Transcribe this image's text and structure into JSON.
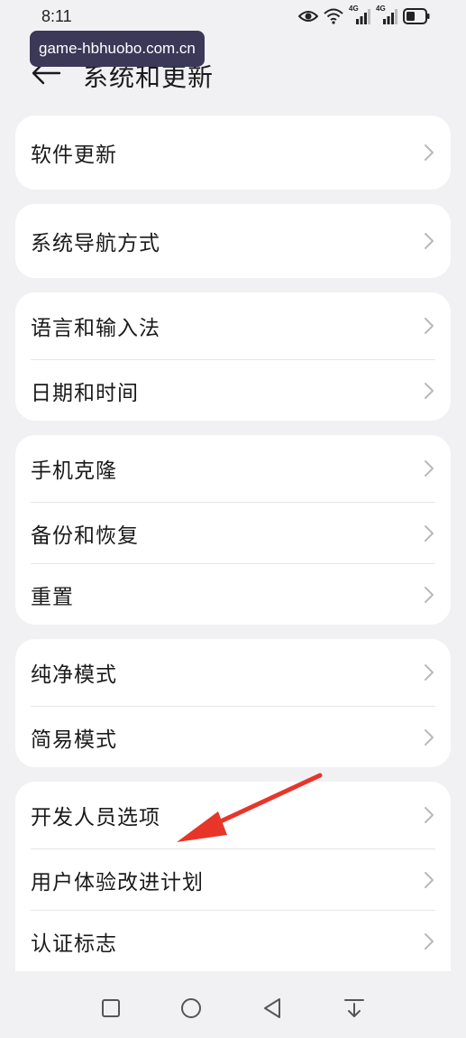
{
  "status_bar": {
    "time": "8:11",
    "network_label_1": "4G",
    "network_label_2": "4G",
    "icons": [
      "eye-icon",
      "wifi-icon",
      "signal-icon",
      "signal-icon",
      "battery-icon"
    ]
  },
  "watermark": {
    "text": "game-hbhuobo.com.cn"
  },
  "header": {
    "title": "系统和更新",
    "back_icon": "back-arrow-icon"
  },
  "groups": [
    {
      "items": [
        {
          "label": "软件更新"
        }
      ]
    },
    {
      "items": [
        {
          "label": "系统导航方式"
        }
      ]
    },
    {
      "items": [
        {
          "label": "语言和输入法"
        },
        {
          "label": "日期和时间"
        }
      ]
    },
    {
      "items": [
        {
          "label": "手机克隆"
        },
        {
          "label": "备份和恢复"
        },
        {
          "label": "重置"
        }
      ]
    },
    {
      "items": [
        {
          "label": "纯净模式"
        },
        {
          "label": "简易模式"
        }
      ]
    },
    {
      "items": [
        {
          "label": "开发人员选项"
        },
        {
          "label": "用户体验改进计划"
        },
        {
          "label": "认证标志"
        }
      ]
    }
  ],
  "annotation": {
    "type": "red-arrow",
    "points_to": "开发人员选项",
    "color": "#e8352a"
  },
  "nav_bar": {
    "buttons": [
      "square-icon",
      "circle-icon",
      "triangle-back-icon",
      "pull-down-icon"
    ]
  },
  "colors": {
    "background": "#f1f1f3",
    "card": "#ffffff",
    "chevron": "#b9b9bd",
    "watermark_bg": "#3b3957"
  }
}
